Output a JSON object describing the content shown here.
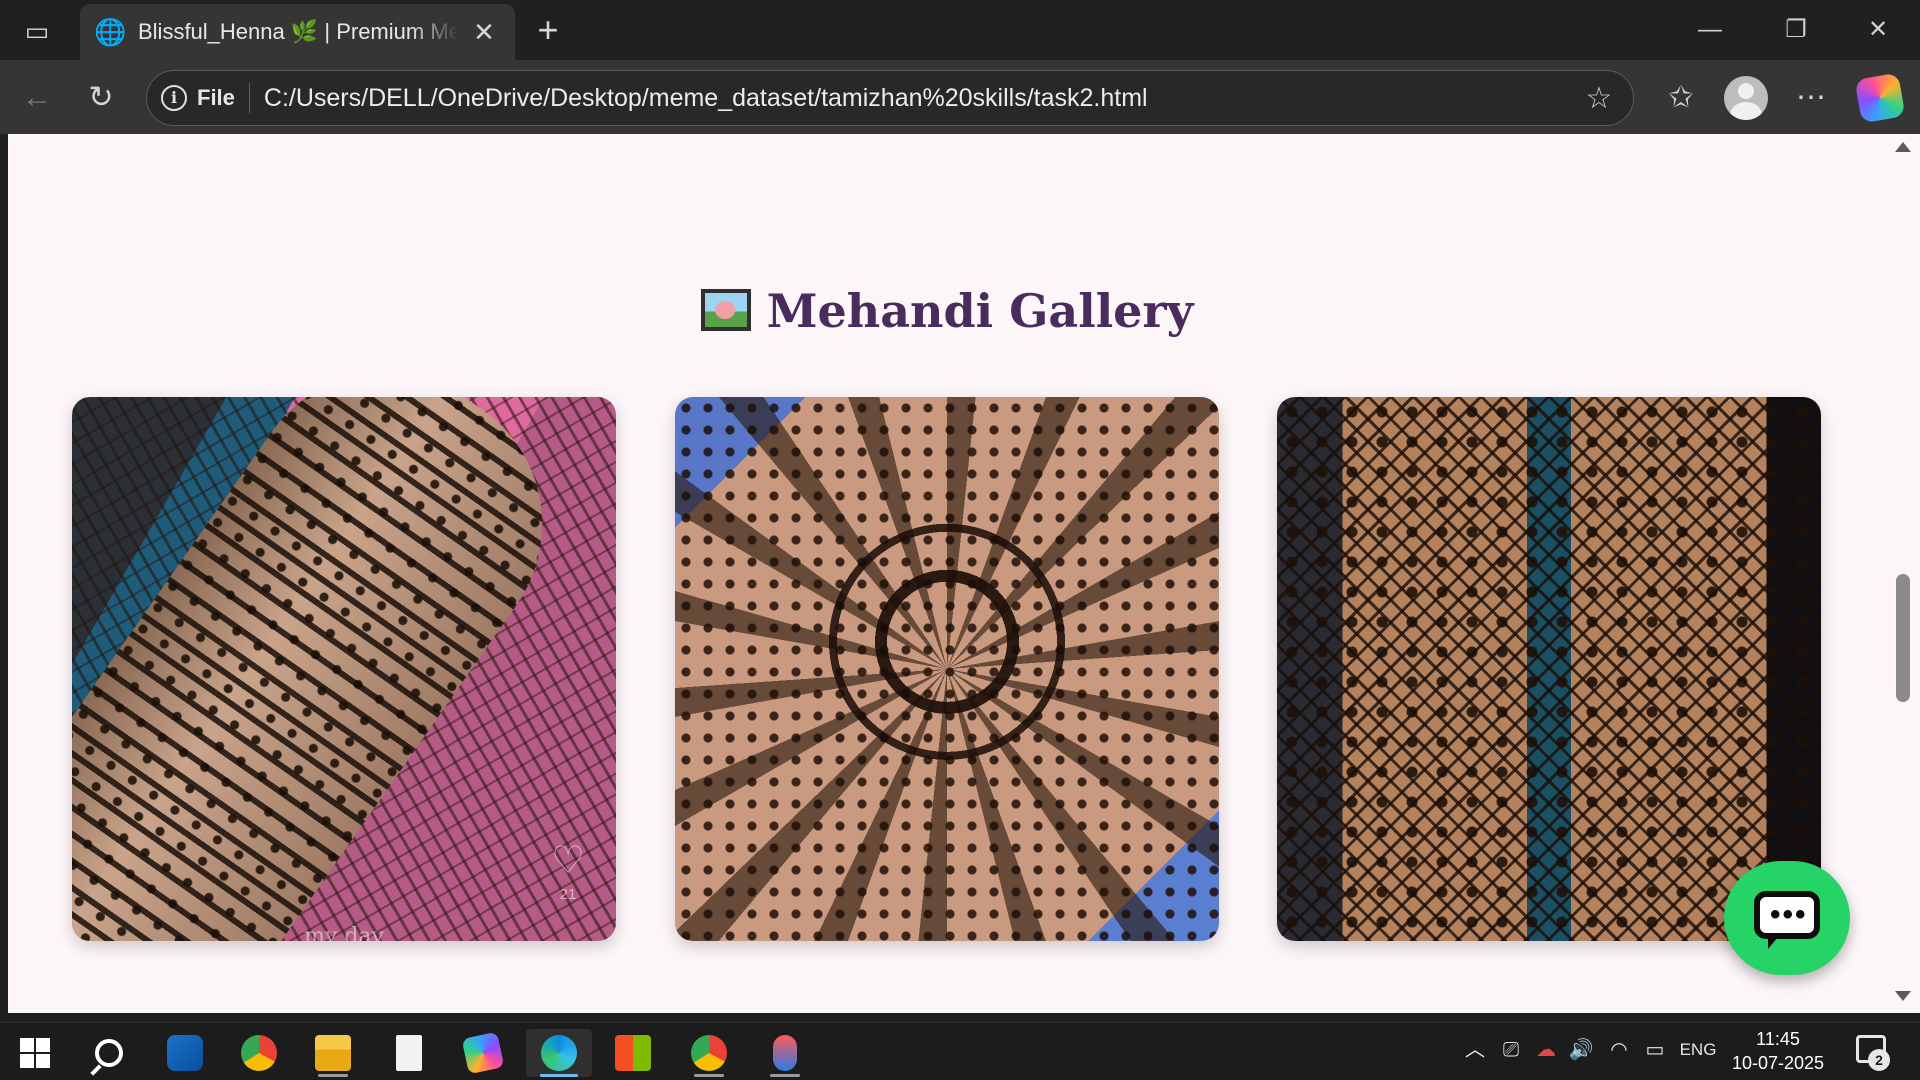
{
  "browser": {
    "tab": {
      "title": "Blissful_Henna 🌿 | Premium Mehandi",
      "icon": "globe-icon"
    },
    "window_controls": [
      "minimize-icon",
      "restore-icon",
      "close-icon"
    ],
    "address_bar": {
      "scheme_label": "File",
      "url": "C:/Users/DELL/OneDrive/Desktop/meme_dataset/tamizhan%20skills/task2.html"
    }
  },
  "page": {
    "section_title": "Mehandi Gallery",
    "gallery": [
      {
        "alt": "mehandi-design-1",
        "likes": "21",
        "caption_peek": "my day"
      },
      {
        "alt": "mehandi-design-2"
      },
      {
        "alt": "mehandi-design-3"
      }
    ]
  },
  "taskbar": {
    "apps": [
      "start",
      "search",
      "outlook",
      "chrome",
      "file-explorer",
      "notepad",
      "copilot",
      "edge",
      "microsoft-store",
      "chrome-profile",
      "snipping-tool"
    ],
    "tray": {
      "language": "ENG"
    },
    "clock": {
      "time": "11:45",
      "date": "10-07-2025"
    },
    "notifications_count": "2"
  },
  "colors": {
    "page_bg": "#fdf6f8",
    "title": "#4a2b5e",
    "chat_button": "#25d366",
    "browser_chrome": "#353535",
    "taskbar": "#1c1c1c"
  }
}
